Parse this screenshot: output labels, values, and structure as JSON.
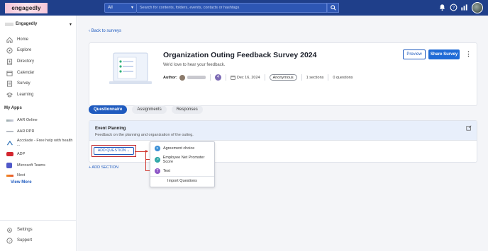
{
  "topbar": {
    "logo_text": "engagedly",
    "search_scope": "All",
    "search_placeholder": "Search for contents, folders, events, contacts or hashtags"
  },
  "sidebar": {
    "org_name": "Engagedly",
    "nav": [
      {
        "label": "Home",
        "icon": "home-icon"
      },
      {
        "label": "Explore",
        "icon": "compass-icon"
      },
      {
        "label": "Directory",
        "icon": "directory-icon"
      },
      {
        "label": "Calendar",
        "icon": "calendar-icon"
      },
      {
        "label": "Survey",
        "icon": "survey-icon"
      },
      {
        "label": "Learning",
        "icon": "learning-icon"
      }
    ],
    "myapps_title": "My Apps",
    "apps": [
      {
        "label": "AAR Online"
      },
      {
        "label": "AAR RPR"
      },
      {
        "label": "Accolade - Free help with health ..."
      },
      {
        "label": "ADP"
      },
      {
        "label": "Microsoft Teams"
      },
      {
        "label": "Next"
      }
    ],
    "view_more": "View More",
    "bottom": [
      {
        "label": "Settings",
        "icon": "gear-icon"
      },
      {
        "label": "Support",
        "icon": "help-icon"
      }
    ]
  },
  "main": {
    "back_link": "Back to surveys",
    "survey": {
      "title": "Organization Outing Feedback Survey 2024",
      "description": "We'd love to hear your feedback.",
      "author_label": "Author:",
      "author_count": "4",
      "date": "Dec 16, 2024",
      "anonymity": "Anonymous",
      "sections": "1 sections",
      "questions": "0 questions",
      "preview_label": "Preview",
      "share_label": "Share Survey"
    },
    "tabs": [
      {
        "label": "Questionnaire",
        "active": true
      },
      {
        "label": "Assignments",
        "active": false
      },
      {
        "label": "Responses",
        "active": false
      }
    ],
    "section": {
      "title": "Event Planning",
      "subtitle": "Feedback on the planning and organization of the outing.",
      "add_question": "ADD QUESTION"
    },
    "add_section": "+ ADD SECTION",
    "question_menu": {
      "items": [
        {
          "label": "Agreement choice",
          "color": "#3a8fd6",
          "glyph": "≡"
        },
        {
          "label": "Employee Net Promoter Score",
          "color": "#2fa8a8",
          "glyph": "↗"
        },
        {
          "label": "Text",
          "color": "#8d57c7",
          "glyph": "T"
        }
      ],
      "import_label": "Import Questions"
    }
  },
  "colors": {
    "topbar": "#1f3f8a",
    "primary": "#1f5bbf",
    "annotation_red": "#c0272d"
  }
}
